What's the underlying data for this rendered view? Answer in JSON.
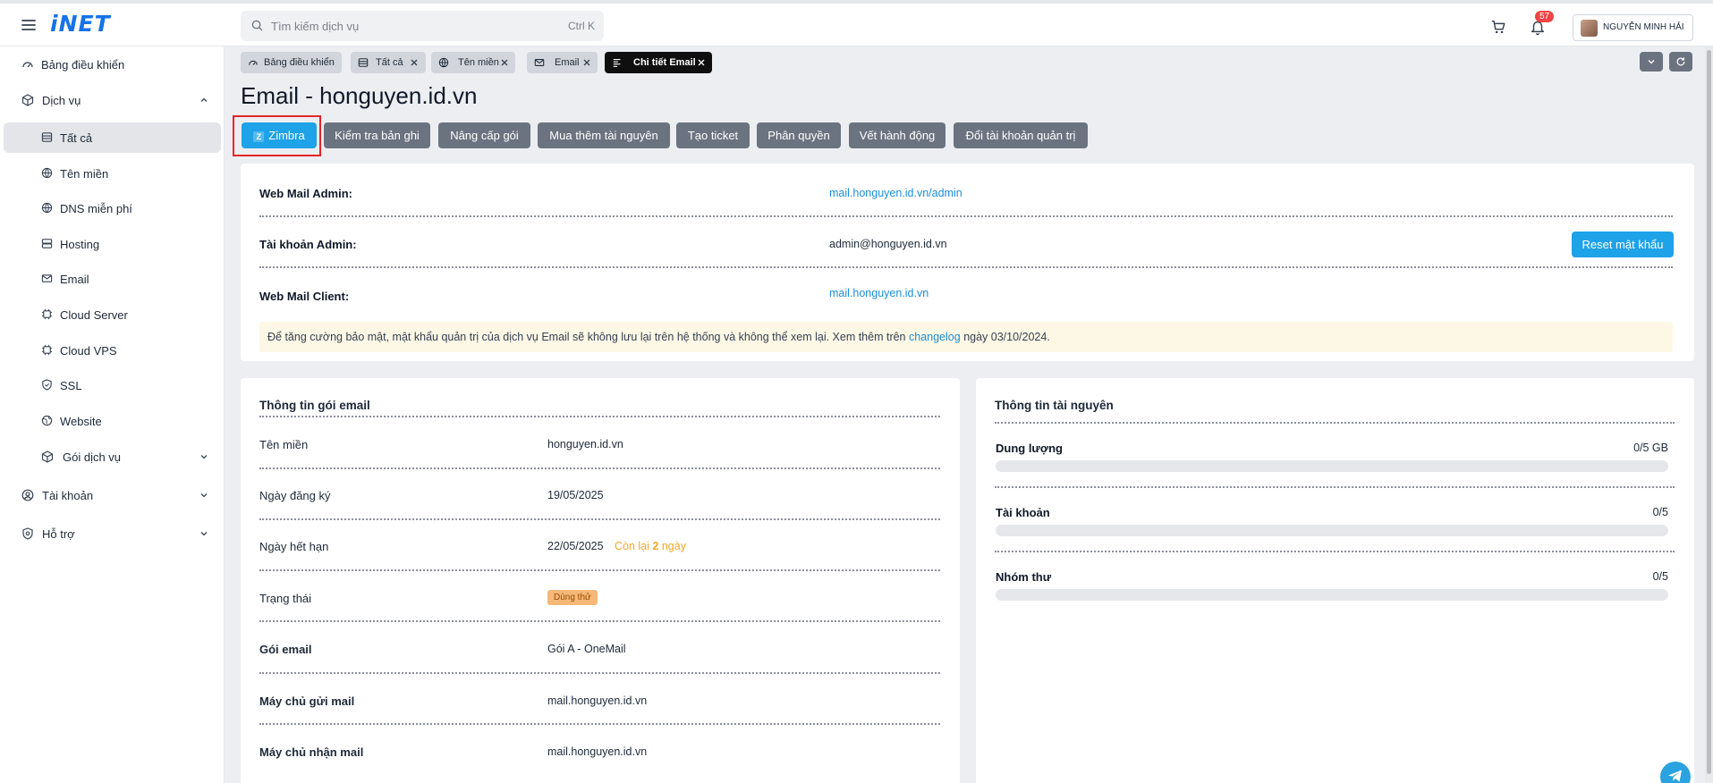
{
  "header": {
    "logo": "iNET",
    "search_placeholder": "Tìm kiếm dịch vụ",
    "search_shortcut": "Ctrl K",
    "notification_count": "57",
    "user_name": "NGUYỄN MINH HẢI"
  },
  "sidebar": {
    "items": [
      {
        "label": "Bảng điều khiển",
        "icon": "gauge-icon"
      },
      {
        "label": "Dịch vụ",
        "icon": "box-icon"
      },
      {
        "label": "Tất cả",
        "icon": "list-icon"
      },
      {
        "label": "Tên miền",
        "icon": "globe-icon"
      },
      {
        "label": "DNS miễn phí",
        "icon": "globe-icon"
      },
      {
        "label": "Hosting",
        "icon": "server-icon"
      },
      {
        "label": "Email",
        "icon": "mail-icon"
      },
      {
        "label": "Cloud Server",
        "icon": "cpu-icon"
      },
      {
        "label": "Cloud VPS",
        "icon": "cpu-icon"
      },
      {
        "label": "SSL",
        "icon": "shield-icon"
      },
      {
        "label": "Website",
        "icon": "web-icon"
      },
      {
        "label": "Gói dịch vụ",
        "icon": "box-icon"
      },
      {
        "label": "Tài khoản",
        "icon": "user-circle-icon"
      },
      {
        "label": "Hỗ trợ",
        "icon": "lifebuoy-icon"
      }
    ]
  },
  "tabs": [
    {
      "label": "Bảng điều khiển"
    },
    {
      "label": "Tất cả"
    },
    {
      "label": "Tên miền"
    },
    {
      "label": "Email"
    },
    {
      "label": "Chi tiết Email"
    }
  ],
  "page": {
    "title": "Email - honguyen.id.vn"
  },
  "actions": {
    "zimbra": "Zimbra",
    "zimbra_letter": "Z",
    "check_records": "Kiểm tra bản ghi",
    "upgrade": "Nâng cấp gói",
    "buy_resources": "Mua thêm tài nguyên",
    "create_ticket": "Tạo ticket",
    "permissions": "Phân quyền",
    "action_trace": "Vết hành động",
    "change_admin": "Đổi tài khoản quản trị"
  },
  "admin_card": {
    "webmail_admin_label": "Web Mail Admin:",
    "webmail_admin_value": "mail.honguyen.id.vn/admin",
    "admin_account_label": "Tài khoản Admin:",
    "admin_account_value": "admin@honguyen.id.vn",
    "reset_password": "Reset mật khẩu",
    "webmail_client_label": "Web Mail Client:",
    "webmail_client_value": "mail.honguyen.id.vn",
    "notice_text": "Để tăng cường bảo mật, mật khẩu quản trị của dịch vụ Email sẽ không lưu lại trên hệ thống và không thể xem lại. Xem thêm trên",
    "notice_link": "changelog",
    "notice_suffix": "ngày 03/10/2024."
  },
  "package_card": {
    "title": "Thông tin gói email",
    "domain_label": "Tên miền",
    "domain_value": "honguyen.id.vn",
    "registered_label": "Ngày đăng ký",
    "registered_value": "19/05/2025",
    "expiry_label": "Ngày hết hạn",
    "expiry_value": "22/05/2025",
    "remaining_prefix": "Còn lại",
    "remaining_days": "2",
    "remaining_suffix": "ngày",
    "status_label": "Trạng thái",
    "status_value": "Dùng thử",
    "plan_label": "Gói email",
    "plan_value": "Gói A - OneMail",
    "smtp_label": "Máy chủ gửi mail",
    "smtp_value": "mail.honguyen.id.vn",
    "imap_label": "Máy chủ nhận mail",
    "imap_value": "mail.honguyen.id.vn"
  },
  "resource_card": {
    "title": "Thông tin tài nguyên",
    "storage_label": "Dung lượng",
    "storage_value": "0/5 GB",
    "storage_fraction": 0,
    "accounts_label": "Tài khoản",
    "accounts_value": "0/5",
    "accounts_fraction": 0,
    "groups_label": "Nhóm thư",
    "groups_value": "0/5",
    "groups_fraction": 0
  },
  "colors": {
    "primary": "#1ea2e8",
    "button_gray": "#6b7380",
    "highlight_border": "#e5252a",
    "warning_text": "#f5a623"
  }
}
